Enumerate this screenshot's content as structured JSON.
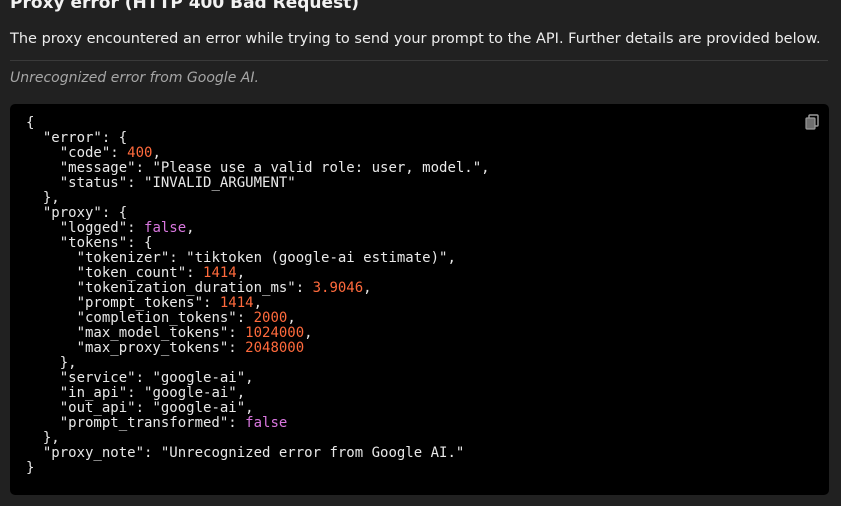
{
  "header": {
    "title": "Proxy error (HTTP 400 Bad Request)",
    "description": "The proxy encountered an error while trying to send your prompt to the API. Further details are provided below.",
    "note": "Unrecognized error from Google AI."
  },
  "code_block": {
    "copy_icon": "copy-icon",
    "keys": {
      "error": "\"error\"",
      "code": "\"code\"",
      "message": "\"message\"",
      "status": "\"status\"",
      "proxy": "\"proxy\"",
      "logged": "\"logged\"",
      "tokens": "\"tokens\"",
      "tokenizer": "\"tokenizer\"",
      "token_count": "\"token_count\"",
      "tokenization_duration_ms": "\"tokenization_duration_ms\"",
      "prompt_tokens": "\"prompt_tokens\"",
      "completion_tokens": "\"completion_tokens\"",
      "max_model_tokens": "\"max_model_tokens\"",
      "max_proxy_tokens": "\"max_proxy_tokens\"",
      "service": "\"service\"",
      "in_api": "\"in_api\"",
      "out_api": "\"out_api\"",
      "prompt_transformed": "\"prompt_transformed\"",
      "proxy_note": "\"proxy_note\""
    },
    "values": {
      "code": "400",
      "message": "\"Please use a valid role: user, model.\"",
      "status": "\"INVALID_ARGUMENT\"",
      "logged": "false",
      "tokenizer": "\"tiktoken (google-ai estimate)\"",
      "token_count": "1414",
      "tokenization_duration_ms": "3.9046",
      "prompt_tokens": "1414",
      "completion_tokens": "2000",
      "max_model_tokens": "1024000",
      "max_proxy_tokens": "2048000",
      "service": "\"google-ai\"",
      "in_api": "\"google-ai\"",
      "out_api": "\"google-ai\"",
      "prompt_transformed": "false",
      "proxy_note": "\"Unrecognized error from Google AI.\""
    }
  }
}
